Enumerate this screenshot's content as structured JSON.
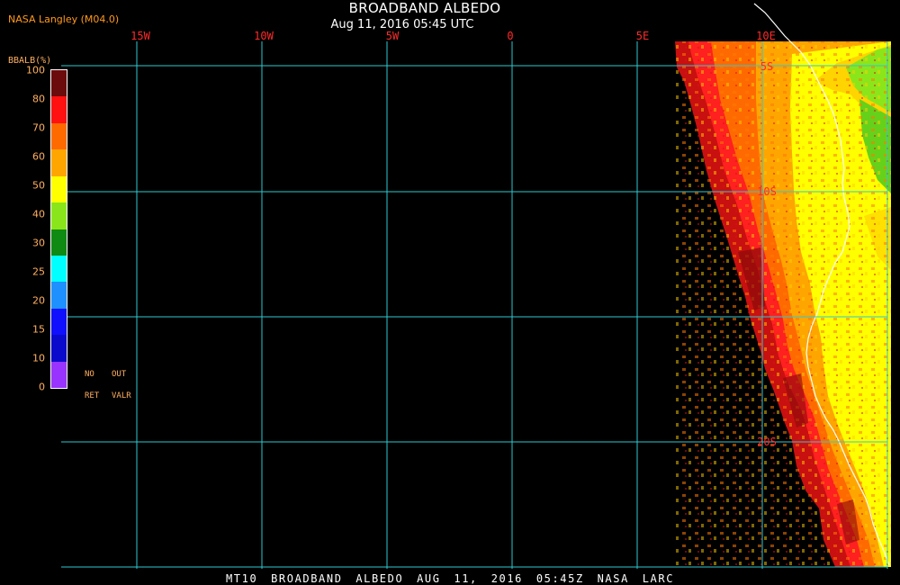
{
  "header": {
    "agency": "NASA Langley (M04.0)",
    "title": "BROADBAND ALBEDO",
    "subtitle": "Aug 11, 2016 05:45 UTC"
  },
  "map": {
    "longitude_labels": [
      "15W",
      "10W",
      "5W",
      "0",
      "5E",
      "10E"
    ],
    "latitude_labels": [
      "5S",
      "10S",
      "20S"
    ],
    "grid_color": "#2ec9cf",
    "label_color": "#ff2a2a",
    "coastline_color": "#ffffff"
  },
  "colorbar": {
    "title": "BBALB(%)",
    "ticks": [
      "100",
      "80",
      "70",
      "60",
      "50",
      "40",
      "30",
      "25",
      "20",
      "15",
      "10",
      "0"
    ],
    "colors": [
      "#6b0b0b",
      "#ff1111",
      "#ff6a00",
      "#ffa500",
      "#ffff00",
      "#8ae61a",
      "#0f8a12",
      "#00ffff",
      "#1e90ff",
      "#1010ff",
      "#0a0acd",
      "#9933ff"
    ],
    "no_retrieval_label": [
      "NO",
      "RET"
    ],
    "out_of_range_label": [
      "OUT",
      "VALR"
    ]
  },
  "footer": {
    "text": "MT10 BROADBAND ALBEDO AUG 11, 2016 05:45Z NASA LARC"
  }
}
